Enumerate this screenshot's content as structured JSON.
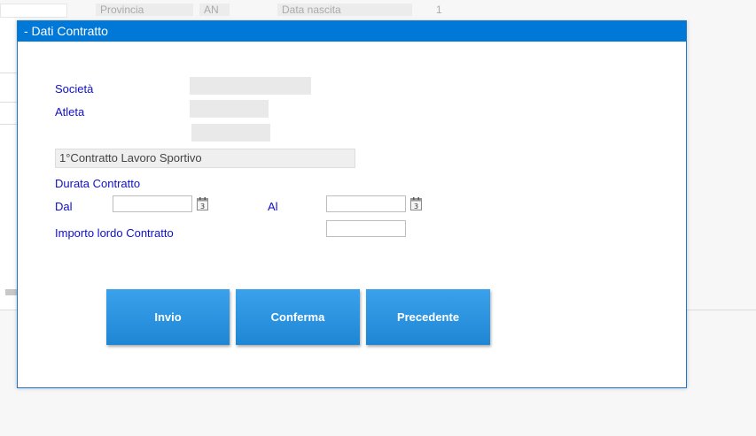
{
  "background": {
    "field_provincia_label": "Provincia",
    "field_provincia_value": "AN",
    "field_data_nascita_label": "Data nascita",
    "field_number": "1"
  },
  "dialog": {
    "title": "- Dati Contratto",
    "societa_label": "Società",
    "atleta_label": "Atleta",
    "contract_type": "1°Contratto Lavoro Sportivo",
    "durata_label": "Durata Contratto",
    "dal_label": "Dal",
    "al_label": "Al",
    "importo_label": "Importo lordo Contratto",
    "dal_value": "",
    "al_value": "",
    "importo_value": "",
    "calendar_day": "3"
  },
  "buttons": {
    "invio": "Invio",
    "conferma": "Conferma",
    "precedente": "Precedente"
  },
  "colors": {
    "header": "#0078d7",
    "label": "#1010c8",
    "button": "#2b93e0"
  },
  "icons": [
    "calendar-icon"
  ]
}
